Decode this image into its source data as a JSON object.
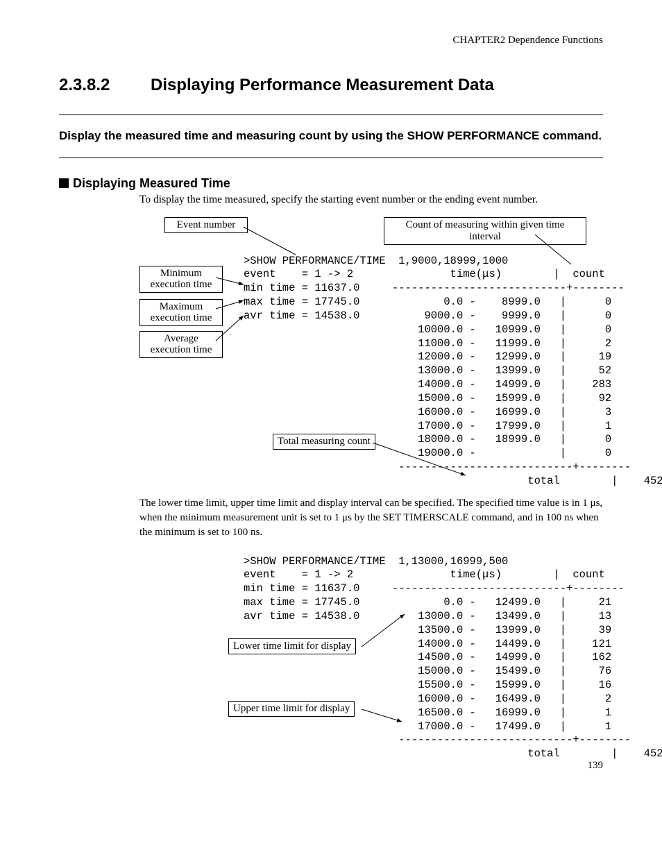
{
  "header": "CHAPTER2  Dependence Functions",
  "section_num": "2.3.8.2",
  "section_title": "Displaying Performance Measurement Data",
  "summary": "Display the measured time and measuring count by using the SHOW PERFORMANCE command.",
  "subhead": "Displaying Measured Time",
  "body1": "To display the time measured, specify the starting event number or the ending event number.",
  "labels": {
    "event_number": "Event number",
    "count_interval": "Count of measuring within given time interval",
    "min_exec": "Minimum\nexecution time",
    "max_exec": "Maximum\nexecution time",
    "avg_exec": "Average\nexecution time",
    "total_count": "Total measuring count",
    "lower_limit": "Lower time limit for display",
    "upper_limit": "Upper time limit for display"
  },
  "example1": {
    "cmd": ">SHOW PERFORMANCE/TIME  1,9000,18999,1000",
    "event": "event    = 1 -> 2",
    "min": "min time = 11637.0",
    "max": "max time = 17745.0",
    "avr": "avr time = 14538.0",
    "time_hdr": "time(",
    "time_hdr2": "s)",
    "count_hdr": "count",
    "rows": [
      {
        "lo": "0.0",
        "hi": "8999.0",
        "c": "0"
      },
      {
        "lo": "9000.0",
        "hi": "9999.0",
        "c": "0"
      },
      {
        "lo": "10000.0",
        "hi": "10999.0",
        "c": "0"
      },
      {
        "lo": "11000.0",
        "hi": "11999.0",
        "c": "2"
      },
      {
        "lo": "12000.0",
        "hi": "12999.0",
        "c": "19"
      },
      {
        "lo": "13000.0",
        "hi": "13999.0",
        "c": "52"
      },
      {
        "lo": "14000.0",
        "hi": "14999.0",
        "c": "283"
      },
      {
        "lo": "15000.0",
        "hi": "15999.0",
        "c": "92"
      },
      {
        "lo": "16000.0",
        "hi": "16999.0",
        "c": "3"
      },
      {
        "lo": "17000.0",
        "hi": "17999.0",
        "c": "1"
      },
      {
        "lo": "18000.0",
        "hi": "18999.0",
        "c": "0"
      },
      {
        "lo": "19000.0",
        "hi": "",
        "c": "0"
      }
    ],
    "total_label": "total",
    "total_val": "452"
  },
  "note": "The lower time limit, upper time limit and display interval can be specified.  The specified time value is in 1 μs, when the minimum measurement unit is set to 1 μs by the SET TIMERSCALE command, and in 100 ns when the minimum is set to 100 ns.",
  "example2": {
    "cmd": ">SHOW PERFORMANCE/TIME  1,13000,16999,500",
    "event": "event    = 1 -> 2",
    "min": "min time = 11637.0",
    "max": "max time = 17745.0",
    "avr": "avr time = 14538.0",
    "time_hdr": "time(",
    "time_hdr2": "s)",
    "count_hdr": "count",
    "rows": [
      {
        "lo": "0.0",
        "hi": "12499.0",
        "c": "21"
      },
      {
        "lo": "13000.0",
        "hi": "13499.0",
        "c": "13"
      },
      {
        "lo": "13500.0",
        "hi": "13999.0",
        "c": "39"
      },
      {
        "lo": "14000.0",
        "hi": "14499.0",
        "c": "121"
      },
      {
        "lo": "14500.0",
        "hi": "14999.0",
        "c": "162"
      },
      {
        "lo": "15000.0",
        "hi": "15499.0",
        "c": "76"
      },
      {
        "lo": "15500.0",
        "hi": "15999.0",
        "c": "16"
      },
      {
        "lo": "16000.0",
        "hi": "16499.0",
        "c": "2"
      },
      {
        "lo": "16500.0",
        "hi": "16999.0",
        "c": "1"
      },
      {
        "lo": "17000.0",
        "hi": "17499.0",
        "c": "1"
      }
    ],
    "total_label": "total",
    "total_val": "452"
  },
  "page_num": "139"
}
